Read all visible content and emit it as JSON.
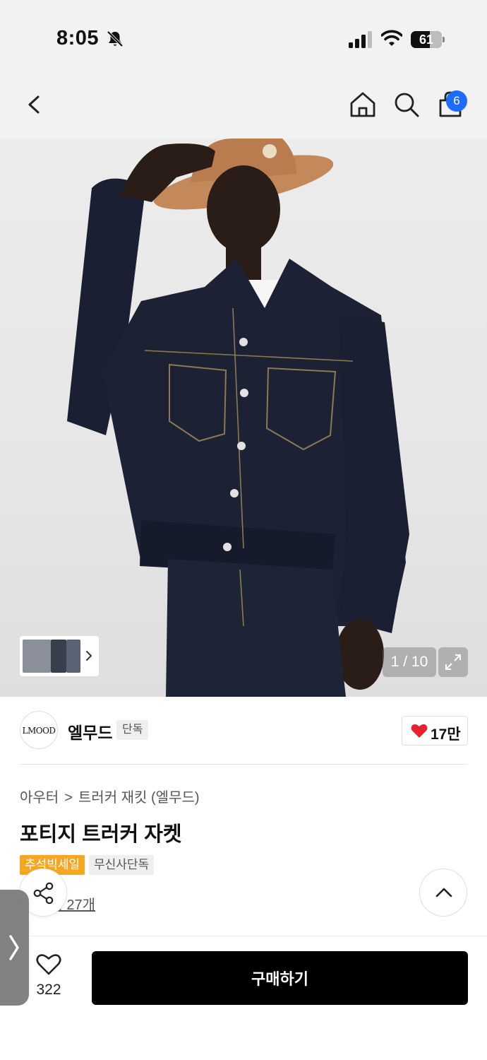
{
  "status_bar": {
    "time": "8:05",
    "battery_level": 61,
    "battery_text": "61"
  },
  "nav": {
    "cart_count": "6",
    "icons": [
      "back-icon",
      "home-icon",
      "search-icon",
      "cart-icon"
    ]
  },
  "gallery": {
    "counter": "1 / 10",
    "expand_icon": "expand-icon",
    "thumbnails_icon": "chevron-right-icon"
  },
  "brand": {
    "logo_text": "LMOOD",
    "name": "엘무드",
    "badge": "단독",
    "like_count": "17만"
  },
  "product": {
    "breadcrumb": [
      "아우터",
      "트러커 재킷 (엘무드)"
    ],
    "title": "포티지 트러커 자켓",
    "tags": [
      "추석빅세일",
      "무신사단독"
    ],
    "reviews": "후기 27개"
  },
  "bottom": {
    "wish_count": "322",
    "buy_label": "구매하기"
  },
  "colors": {
    "accent_blue": "#1f6bff",
    "sale_orange": "#f5a623",
    "like_red": "#e8212e",
    "buy_black": "#000000"
  }
}
